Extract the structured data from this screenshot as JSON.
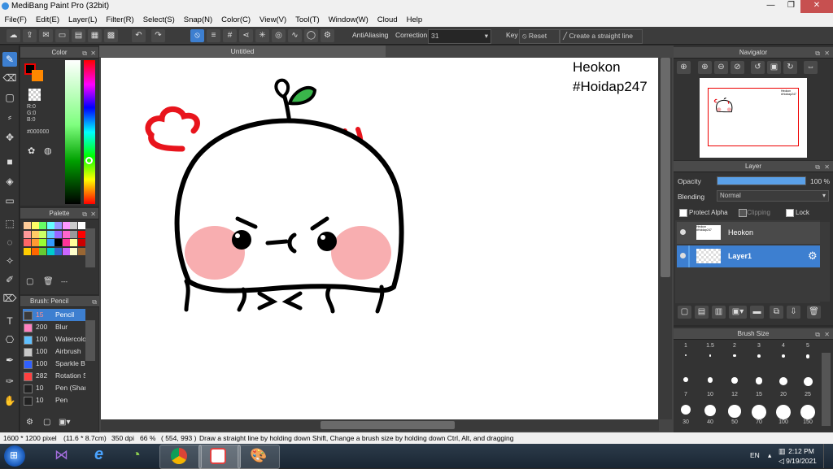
{
  "window": {
    "title": "MediBang Paint Pro (32bit)"
  },
  "menu": [
    "File(F)",
    "Edit(E)",
    "Layer(L)",
    "Filter(R)",
    "Select(S)",
    "Snap(N)",
    "Color(C)",
    "View(V)",
    "Tool(T)",
    "Window(W)",
    "Cloud",
    "Help"
  ],
  "toolbar": {
    "antialiasing_label": "AntiAliasing",
    "correction_label": "Correction",
    "correction_value": "31",
    "key_label": "Key",
    "reset_label": "Reset",
    "straight_line_label": "Create a straight line"
  },
  "color_panel": {
    "title": "Color",
    "r": "R:0",
    "g": "G:0",
    "b": "B:0",
    "hex": "#000000"
  },
  "palette_panel": {
    "title": "Palette",
    "swatches": [
      "#ffcc99",
      "#ffff66",
      "#66ff66",
      "#66ffff",
      "#9999ff",
      "#ff99ff",
      "#cccccc",
      "#ffffff",
      "#ff9999",
      "#ffcc66",
      "#ccff66",
      "#66ccff",
      "#9966ff",
      "#ff66cc",
      "#999999",
      "#ff0000",
      "#ff6666",
      "#ff9933",
      "#99ff33",
      "#3399ff",
      "#000000",
      "#ff3399",
      "#ffff99",
      "#cc0000",
      "#ffcc00",
      "#ff6600",
      "#66cc33",
      "#00cccc",
      "#3366cc",
      "#cc66ff",
      "#ffffcc",
      "#996633"
    ],
    "more": "---"
  },
  "brush_panel": {
    "title": "Brush: Pencil",
    "items": [
      {
        "size": "15",
        "name": "Pencil",
        "color": "#3a3a3a"
      },
      {
        "size": "200",
        "name": "Blur",
        "color": "#ff80c0"
      },
      {
        "size": "100",
        "name": "Watercolor",
        "color": "#60c0ff"
      },
      {
        "size": "100",
        "name": "Airbrush",
        "color": "#c8c8c8"
      },
      {
        "size": "100",
        "name": "Sparkle Brush",
        "color": "#3060ff"
      },
      {
        "size": "282",
        "name": "Rotation Symmetry",
        "color": "#ff4040"
      },
      {
        "size": "10",
        "name": "Pen (Sharp)",
        "color": "#222222"
      },
      {
        "size": "10",
        "name": "Pen",
        "color": "#222222"
      }
    ]
  },
  "document": {
    "tab_title": "Untitled",
    "text_line1": "Heokon",
    "text_line2": "#Hoidap247"
  },
  "navigator": {
    "title": "Navigator",
    "thumb_text_line1": "Heokon",
    "thumb_text_line2": "#Hoidap247"
  },
  "layer_panel": {
    "title": "Layer",
    "opacity_label": "Opacity",
    "opacity_value": "100 %",
    "opacity_fraction": 1.0,
    "blending_label": "Blending",
    "blending_value": "Normal",
    "protect_alpha": "Protect Alpha",
    "clipping": "Clipping",
    "lock": "Lock",
    "layers": [
      {
        "name": "Heokon",
        "selected": false
      },
      {
        "name": "Layer1",
        "selected": true
      }
    ]
  },
  "brush_size_panel": {
    "title": "Brush Size",
    "sizes": [
      "1",
      "1.5",
      "2",
      "3",
      "4",
      "5",
      "7",
      "10",
      "12",
      "15",
      "20",
      "25",
      "30",
      "40",
      "50",
      "70",
      "100",
      "150"
    ]
  },
  "status": {
    "size": "1600 * 1200 pixel",
    "cm": "(11.6 * 8.7cm)",
    "dpi": "350 dpi",
    "zoom": "66 %",
    "coords": "( 554, 993 )",
    "hint": "Draw a straight line by holding down Shift, Change a brush size by holding down Ctrl, Alt, and dragging"
  },
  "taskbar": {
    "lang": "EN",
    "time": "2:12 PM",
    "date": "9/19/2021"
  },
  "colors": {
    "accent": "#3d7fd0",
    "face_stroke": "#000000",
    "angry": "#e8141c",
    "blush": "#f8aeb0",
    "sprout": "#39b54a"
  }
}
